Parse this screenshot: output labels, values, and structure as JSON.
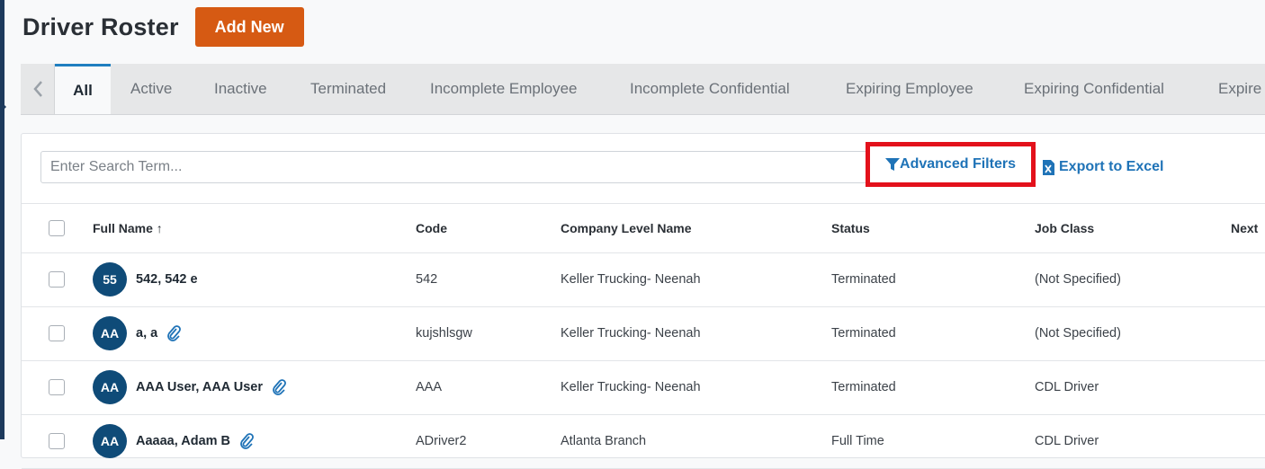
{
  "header": {
    "title": "Driver Roster",
    "add_label": "Add New"
  },
  "tabs": [
    "All",
    "Active",
    "Inactive",
    "Terminated",
    "Incomplete Employee",
    "Incomplete Confidential",
    "Expiring Employee",
    "Expiring Confidential",
    "Expire"
  ],
  "toolbar": {
    "search_placeholder": "Enter Search Term...",
    "advanced_filters": "Advanced Filters",
    "export": "Export to Excel"
  },
  "columns": [
    "Full Name ↑",
    "Code",
    "Company Level Name",
    "Status",
    "Job Class",
    "Next"
  ],
  "rows": [
    {
      "initials": "55",
      "name": "542, 542 e",
      "attachment": false,
      "code": "542",
      "company": "Keller Trucking- Neenah",
      "status": "Terminated",
      "job_class": "(Not Specified)"
    },
    {
      "initials": "AA",
      "name": "a, a",
      "attachment": true,
      "code": "kujshlsgw",
      "company": "Keller Trucking- Neenah",
      "status": "Terminated",
      "job_class": "(Not Specified)"
    },
    {
      "initials": "AA",
      "name": "AAA User, AAA User",
      "attachment": true,
      "code": "AAA",
      "company": "Keller Trucking- Neenah",
      "status": "Terminated",
      "job_class": "CDL Driver"
    },
    {
      "initials": "AA",
      "name": "Aaaaa, Adam B",
      "attachment": true,
      "code": "ADriver2",
      "company": "Atlanta Branch",
      "status": "Full Time",
      "job_class": "CDL Driver"
    }
  ],
  "colors": {
    "accent": "#1f73b7",
    "brand": "#d65a13",
    "avatar": "#0f4b78",
    "highlight": "#e3111b"
  }
}
